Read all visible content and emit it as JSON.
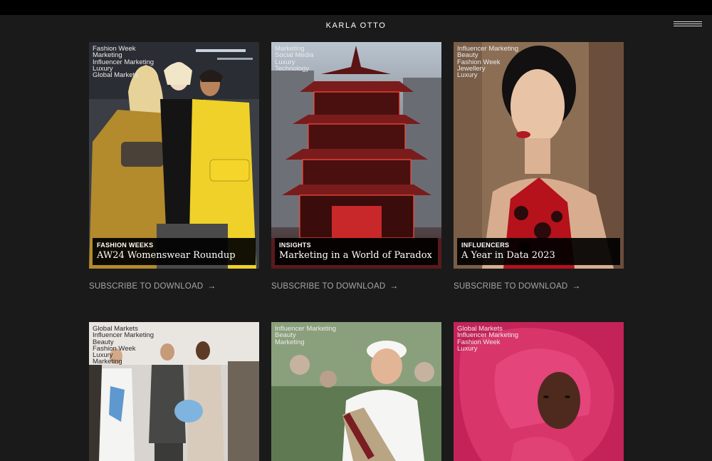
{
  "header": {
    "logo": "KARLA OTTO"
  },
  "cards": [
    {
      "tags": [
        "Fashion Week",
        "Marketing",
        "Influencer Marketing",
        "Luxury",
        "Global Markets"
      ],
      "category": "FASHION WEEKS",
      "title": "AW24 Womenswear Roundup",
      "cta": "SUBSCRIBE TO DOWNLOAD"
    },
    {
      "tags": [
        "Marketing",
        "Social Media",
        "Luxury",
        "Technology"
      ],
      "category": "INSIGHTS",
      "title": "Marketing in a World of Paradox",
      "cta": "SUBSCRIBE TO DOWNLOAD"
    },
    {
      "tags": [
        "Influencer Marketing",
        "Beauty",
        "Fashion Week",
        "Jewellery",
        "Luxury"
      ],
      "category": "INFLUENCERS",
      "title": "A Year in Data 2023",
      "cta": "SUBSCRIBE TO DOWNLOAD"
    },
    {
      "tags": [
        "Global Markets",
        "Influencer Marketing",
        "Beauty",
        "Fashion Week",
        "Luxury",
        "Marketing"
      ]
    },
    {
      "tags": [
        "Influencer Marketing",
        "Beauty",
        "Marketing"
      ]
    },
    {
      "tags": [
        "Global Markets",
        "Influencer Marketing",
        "Fashion Week",
        "Luxury"
      ]
    }
  ],
  "icons": {
    "menu": "hamburger-menu-icon",
    "arrow": "arrow-right-icon"
  }
}
